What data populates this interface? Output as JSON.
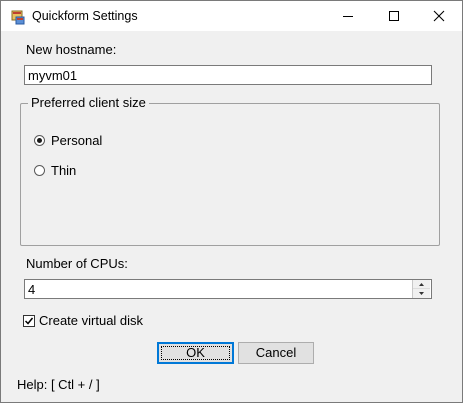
{
  "window": {
    "title": "Quickform Settings",
    "controls": {
      "minimize": "minimize",
      "maximize": "maximize",
      "close": "close"
    }
  },
  "form": {
    "hostname": {
      "label": "New hostname:",
      "value": "myvm01"
    },
    "client_size": {
      "legend": "Preferred client size",
      "options": [
        {
          "label": "Personal",
          "selected": true
        },
        {
          "label": "Thin",
          "selected": false
        }
      ]
    },
    "cpus": {
      "label": "Number of CPUs:",
      "value": "4"
    },
    "virtual_disk": {
      "label": "Create virtual disk",
      "checked": true
    }
  },
  "buttons": {
    "ok": "OK",
    "cancel": "Cancel"
  },
  "help": "Help: [ Ctl + / ]",
  "icons": [
    "app-form-icon",
    "minimize-icon",
    "maximize-icon",
    "close-icon",
    "spin-up-icon",
    "spin-down-icon",
    "check-icon"
  ],
  "colors": {
    "titlebar": "#ffffff",
    "body": "#f0f0f0",
    "focus_border": "#0078d7",
    "button_face": "#e1e1e1"
  }
}
